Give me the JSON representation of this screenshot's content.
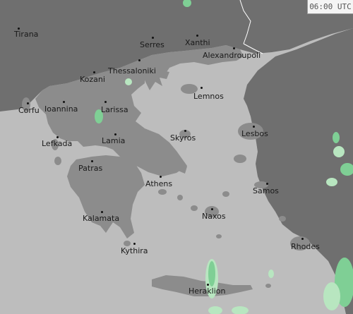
{
  "map": {
    "timestamp": "06:00 UTC",
    "colors": {
      "sea": "#bdbdbd",
      "land_neighbor": "#6f6f6f",
      "land_greece": "#8c8c8c",
      "border": "#ffffff",
      "precip_light": "#b8e6c0",
      "precip_medium": "#7fcf95",
      "city_label": "#1a1a1a"
    },
    "cities": [
      {
        "id": "tirana",
        "name": "Tirana"
      },
      {
        "id": "serres",
        "name": "Serres"
      },
      {
        "id": "xanthi",
        "name": "Xanthi"
      },
      {
        "id": "alexandroupoli",
        "name": "Alexandroupoli"
      },
      {
        "id": "thessaloniki",
        "name": "Thessaloniki"
      },
      {
        "id": "kozani",
        "name": "Kozani"
      },
      {
        "id": "lemnos",
        "name": "Lemnos"
      },
      {
        "id": "corfu",
        "name": "Corfu"
      },
      {
        "id": "ioannina",
        "name": "Ioannina"
      },
      {
        "id": "larissa",
        "name": "Larissa"
      },
      {
        "id": "lesbos",
        "name": "Lesbos"
      },
      {
        "id": "skyros",
        "name": "Skyros"
      },
      {
        "id": "lefkada",
        "name": "Lefkada"
      },
      {
        "id": "lamia",
        "name": "Lamia"
      },
      {
        "id": "patras",
        "name": "Patras"
      },
      {
        "id": "athens",
        "name": "Athens"
      },
      {
        "id": "samos",
        "name": "Samos"
      },
      {
        "id": "naxos",
        "name": "Naxos"
      },
      {
        "id": "kalamata",
        "name": "Kalamata"
      },
      {
        "id": "rhodes",
        "name": "Rhodes"
      },
      {
        "id": "kythira",
        "name": "Kythira"
      },
      {
        "id": "heraklion",
        "name": "Heraklion"
      }
    ]
  }
}
